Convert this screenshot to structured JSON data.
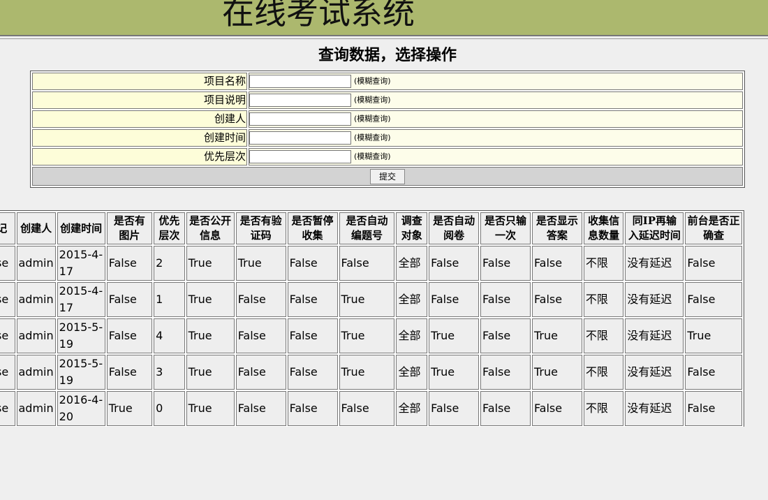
{
  "header": {
    "title": "在线考试系统"
  },
  "page_heading": "查询数据，选择操作",
  "search_form": {
    "fields": [
      {
        "label": "项目名称",
        "value": "",
        "hint": "(模糊查询)"
      },
      {
        "label": "项目说明",
        "value": "",
        "hint": "(模糊查询)"
      },
      {
        "label": "创建人",
        "value": "",
        "hint": "(模糊查询)"
      },
      {
        "label": "创建时间",
        "value": "",
        "hint": "(模糊查询)"
      },
      {
        "label": "优先层次",
        "value": "",
        "hint": "(模糊查询)"
      }
    ],
    "submit_label": "提交"
  },
  "results": {
    "columns": [
      "登记",
      "创建人",
      "创建时间",
      "是否有图片",
      "优先层次",
      "是否公开信息",
      "是否有验证码",
      "是否暂停收集",
      "是否自动编题号",
      "调查对象",
      "是否自动阅卷",
      "是否只输一次",
      "是否显示答案",
      "收集信息数量",
      "同IP再输入延迟时间",
      "前台是否正确查"
    ],
    "rows": [
      [
        "False",
        "admin",
        "2015-4-17",
        "False",
        "2",
        "True",
        "True",
        "False",
        "False",
        "全部",
        "False",
        "False",
        "False",
        "不限",
        "没有延迟",
        "False"
      ],
      [
        "False",
        "admin",
        "2015-4-17",
        "False",
        "1",
        "True",
        "False",
        "False",
        "True",
        "全部",
        "False",
        "False",
        "False",
        "不限",
        "没有延迟",
        "False"
      ],
      [
        "False",
        "admin",
        "2015-5-19",
        "False",
        "4",
        "True",
        "False",
        "False",
        "True",
        "全部",
        "True",
        "False",
        "True",
        "不限",
        "没有延迟",
        "True"
      ],
      [
        "False",
        "admin",
        "2015-5-19",
        "False",
        "3",
        "True",
        "False",
        "False",
        "True",
        "全部",
        "True",
        "False",
        "True",
        "不限",
        "没有延迟",
        "False"
      ],
      [
        "False",
        "admin",
        "2016-4-20",
        "True",
        "0",
        "True",
        "False",
        "False",
        "False",
        "全部",
        "False",
        "False",
        "False",
        "不限",
        "没有延迟",
        "False"
      ]
    ]
  },
  "colors": {
    "banner": "#acb86e",
    "label_bg": "#fdfdd9",
    "action_bg": "#d3d3d3",
    "cell_bg": "#eeeeee"
  }
}
